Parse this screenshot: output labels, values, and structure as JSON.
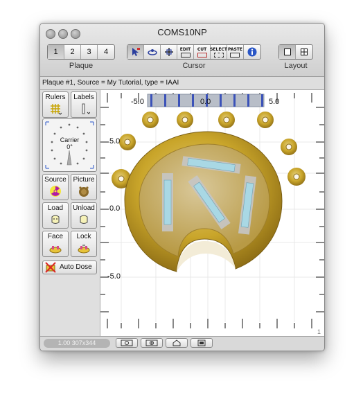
{
  "window": {
    "title": "COMS10NP"
  },
  "toolbar": {
    "plaque": {
      "label": "Plaque",
      "buttons": [
        "1",
        "2",
        "3",
        "4"
      ],
      "selected": "1"
    },
    "cursor": {
      "label": "Cursor",
      "tools": [
        {
          "name": "select-arrow",
          "icon": "arrow-icon"
        },
        {
          "name": "rotate",
          "icon": "rotate-icon"
        },
        {
          "name": "move",
          "icon": "move-icon"
        },
        {
          "name": "edit",
          "icon": "edit-icon",
          "text": "EDIT"
        },
        {
          "name": "cut",
          "icon": "cut-icon",
          "text": "CUT"
        },
        {
          "name": "select",
          "icon": "select-icon",
          "text": "SELECT"
        },
        {
          "name": "paste",
          "icon": "paste-icon",
          "text": "PASTE"
        },
        {
          "name": "info",
          "icon": "info-icon"
        }
      ]
    },
    "layout": {
      "label": "Layout"
    }
  },
  "info_bar": {
    "text": "Plaque #1, Source = My Tutorial, type = IAAI"
  },
  "sidebar": {
    "rulers": "Rulers",
    "labels": "Labels",
    "carrier": {
      "label": "Carrier",
      "angle": "0°"
    },
    "source": "Source",
    "picture": "Picture",
    "load": "Load",
    "unload": "Unload",
    "face": "Face",
    "lock": "Lock",
    "auto_dose": "Auto Dose"
  },
  "canvas": {
    "x_ticks": [
      "-5.0",
      "0.0",
      "5.0"
    ],
    "y_ticks": [
      "5.0",
      "0.0",
      "-5.0"
    ],
    "page_number": "1"
  },
  "status": {
    "zoom": "1.00 307x344"
  },
  "colors": {
    "gold": "#c9a52a",
    "seed_blue": "#a9d8e4",
    "window_bg": "#d7d7d7"
  }
}
